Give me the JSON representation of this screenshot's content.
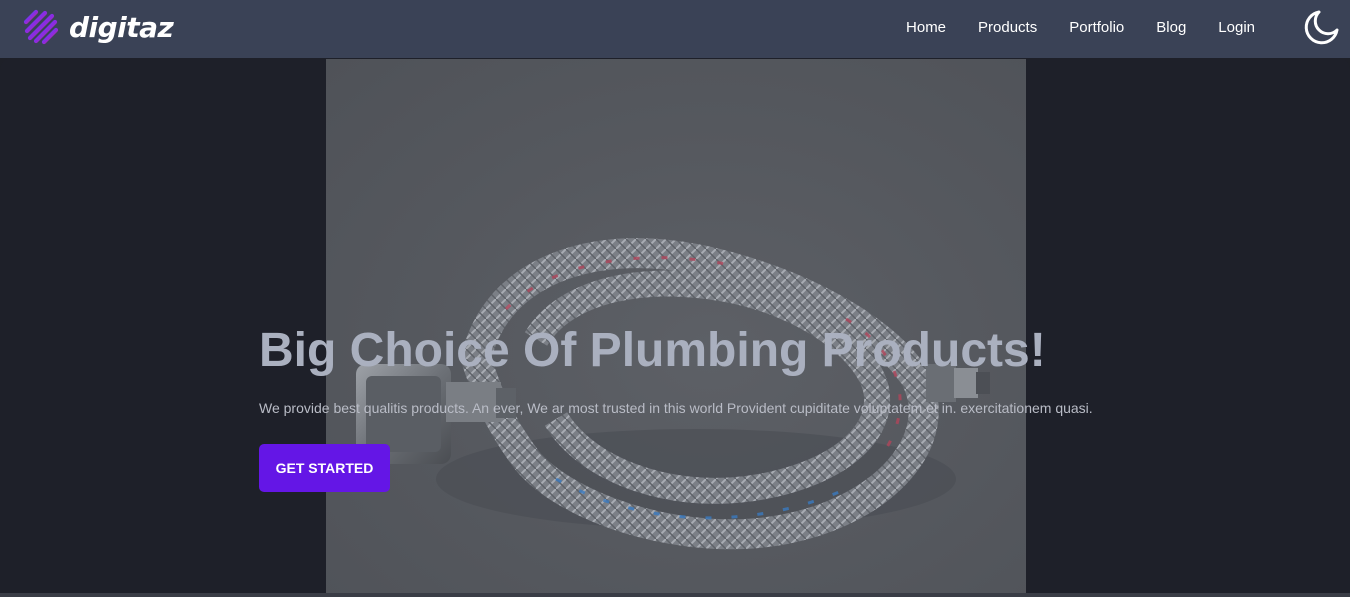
{
  "brand": {
    "name": "digitaz",
    "logo_icon": "striped-stacked-bars-logo",
    "logo_colors": [
      "#3b5bff",
      "#8a2be2",
      "#e0305a"
    ]
  },
  "nav": {
    "items": [
      {
        "label": "Home"
      },
      {
        "label": "Products"
      },
      {
        "label": "Portfolio"
      },
      {
        "label": "Blog"
      },
      {
        "label": "Login"
      }
    ],
    "theme_toggle_icon": "crescent-moon-icon"
  },
  "hero": {
    "title": "Big Choice Of Plumbing Products!",
    "subtitle": "We provide best qualitis products. An ever, We ar most trusted in this world Provident cupiditate voluptatem et in. exercitationem quasi.",
    "cta_label": "GET STARTED",
    "image_icon": "braided-plumbing-hose-photo",
    "accent_color": "#6416e6"
  }
}
